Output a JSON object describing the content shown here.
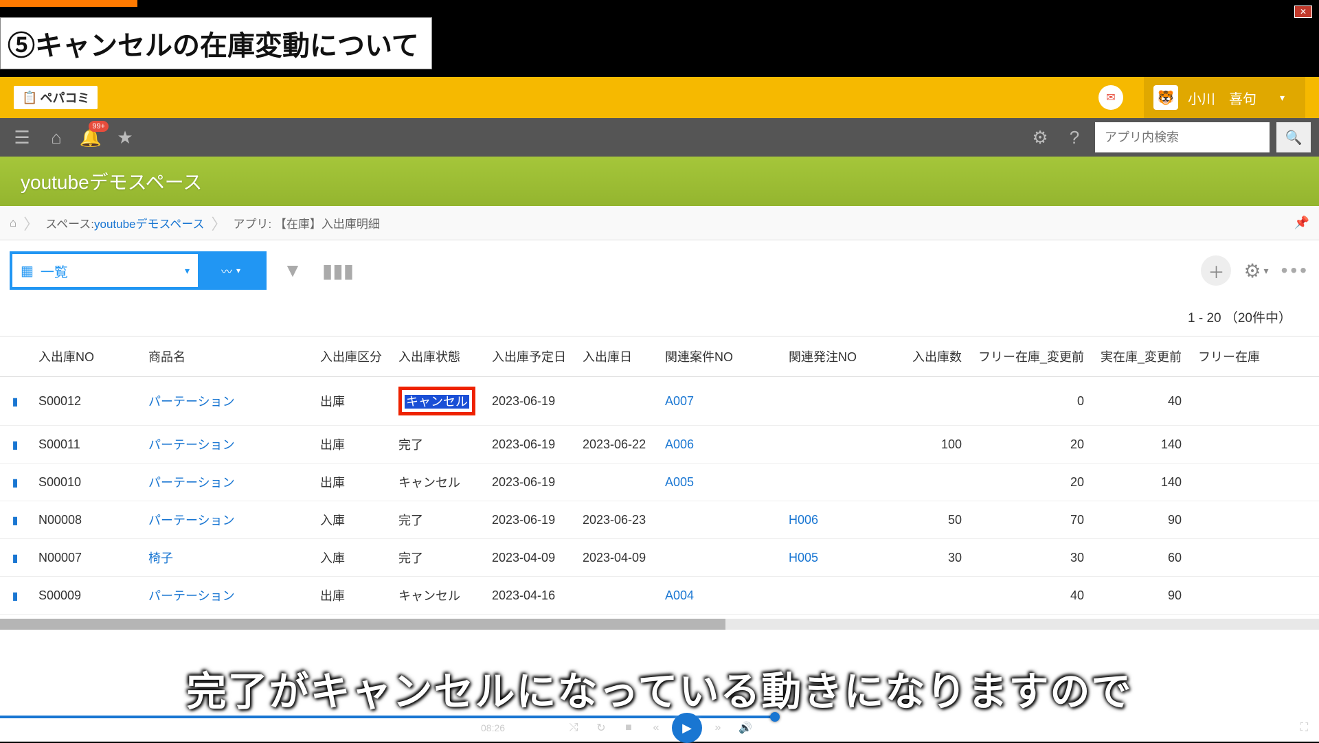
{
  "banner_title": "⑤キャンセルの在庫変動について",
  "logo_text": "ペパコミ",
  "user_name": "小川　喜句",
  "notif_badge": "99+",
  "search_placeholder": "アプリ内検索",
  "space_title": "youtubeデモスペース",
  "crumb": {
    "space_label": "スペース: ",
    "space_link": "youtubeデモスペース",
    "app_label": "アプリ:  【在庫】入出庫明細"
  },
  "view_label": "一覧",
  "pager_text": "1 - 20  （20件中）",
  "columns": [
    "入出庫NO",
    "商品名",
    "入出庫区分",
    "入出庫状態",
    "入出庫予定日",
    "入出庫日",
    "関連案件NO",
    "関連発注NO",
    "入出庫数",
    "フリー在庫_変更前",
    "実在庫_変更前",
    "フリー在庫"
  ],
  "rows": [
    {
      "no": "S00012",
      "name": "パーテーション",
      "kubun": "出庫",
      "status": "キャンセル",
      "status_hl": true,
      "yotei": "2023-06-19",
      "jitsu": "",
      "anken": "A007",
      "order": "",
      "qty": "",
      "free": "0",
      "stock": "40"
    },
    {
      "no": "S00011",
      "name": "パーテーション",
      "kubun": "出庫",
      "status": "完了",
      "yotei": "2023-06-19",
      "jitsu": "2023-06-22",
      "anken": "A006",
      "order": "",
      "qty": "100",
      "free": "20",
      "stock": "140"
    },
    {
      "no": "S00010",
      "name": "パーテーション",
      "kubun": "出庫",
      "status": "キャンセル",
      "yotei": "2023-06-19",
      "jitsu": "",
      "anken": "A005",
      "order": "",
      "qty": "",
      "free": "20",
      "stock": "140"
    },
    {
      "no": "N00008",
      "name": "パーテーション",
      "kubun": "入庫",
      "status": "完了",
      "yotei": "2023-06-19",
      "jitsu": "2023-06-23",
      "anken": "",
      "order": "H006",
      "qty": "50",
      "free": "70",
      "stock": "90"
    },
    {
      "no": "N00007",
      "name": "椅子",
      "kubun": "入庫",
      "status": "完了",
      "yotei": "2023-04-09",
      "jitsu": "2023-04-09",
      "anken": "",
      "order": "H005",
      "qty": "30",
      "free": "30",
      "stock": "60"
    },
    {
      "no": "S00009",
      "name": "パーテーション",
      "kubun": "出庫",
      "status": "キャンセル",
      "yotei": "2023-04-16",
      "jitsu": "",
      "anken": "A004",
      "order": "",
      "qty": "",
      "free": "40",
      "stock": "90"
    }
  ],
  "subtitle": "完了がキャンセルになっている動きになりますので",
  "video_time": "08:26"
}
